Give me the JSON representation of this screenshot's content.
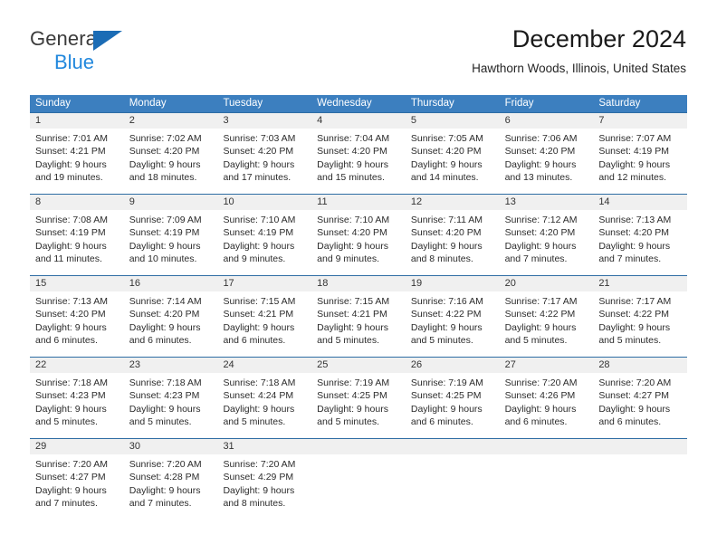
{
  "logo": {
    "word1": "General",
    "word2": "Blue",
    "triangle_color": "#1b6cb5",
    "word2_color": "#2288dd"
  },
  "header": {
    "title": "December 2024",
    "subtitle": "Hawthorn Woods, Illinois, United States"
  },
  "colors": {
    "header_row_bg": "#3c7fbf",
    "week_divider": "#2e6da4",
    "daynum_band_bg": "#f0f0f0",
    "text": "#2b2b2b"
  },
  "calendar": {
    "day_headers": [
      "Sunday",
      "Monday",
      "Tuesday",
      "Wednesday",
      "Thursday",
      "Friday",
      "Saturday"
    ],
    "weeks": [
      {
        "days": [
          {
            "num": "1",
            "sunrise": "Sunrise: 7:01 AM",
            "sunset": "Sunset: 4:21 PM",
            "daylight1": "Daylight: 9 hours",
            "daylight2": "and 19 minutes."
          },
          {
            "num": "2",
            "sunrise": "Sunrise: 7:02 AM",
            "sunset": "Sunset: 4:20 PM",
            "daylight1": "Daylight: 9 hours",
            "daylight2": "and 18 minutes."
          },
          {
            "num": "3",
            "sunrise": "Sunrise: 7:03 AM",
            "sunset": "Sunset: 4:20 PM",
            "daylight1": "Daylight: 9 hours",
            "daylight2": "and 17 minutes."
          },
          {
            "num": "4",
            "sunrise": "Sunrise: 7:04 AM",
            "sunset": "Sunset: 4:20 PM",
            "daylight1": "Daylight: 9 hours",
            "daylight2": "and 15 minutes."
          },
          {
            "num": "5",
            "sunrise": "Sunrise: 7:05 AM",
            "sunset": "Sunset: 4:20 PM",
            "daylight1": "Daylight: 9 hours",
            "daylight2": "and 14 minutes."
          },
          {
            "num": "6",
            "sunrise": "Sunrise: 7:06 AM",
            "sunset": "Sunset: 4:20 PM",
            "daylight1": "Daylight: 9 hours",
            "daylight2": "and 13 minutes."
          },
          {
            "num": "7",
            "sunrise": "Sunrise: 7:07 AM",
            "sunset": "Sunset: 4:19 PM",
            "daylight1": "Daylight: 9 hours",
            "daylight2": "and 12 minutes."
          }
        ]
      },
      {
        "days": [
          {
            "num": "8",
            "sunrise": "Sunrise: 7:08 AM",
            "sunset": "Sunset: 4:19 PM",
            "daylight1": "Daylight: 9 hours",
            "daylight2": "and 11 minutes."
          },
          {
            "num": "9",
            "sunrise": "Sunrise: 7:09 AM",
            "sunset": "Sunset: 4:19 PM",
            "daylight1": "Daylight: 9 hours",
            "daylight2": "and 10 minutes."
          },
          {
            "num": "10",
            "sunrise": "Sunrise: 7:10 AM",
            "sunset": "Sunset: 4:19 PM",
            "daylight1": "Daylight: 9 hours",
            "daylight2": "and 9 minutes."
          },
          {
            "num": "11",
            "sunrise": "Sunrise: 7:10 AM",
            "sunset": "Sunset: 4:20 PM",
            "daylight1": "Daylight: 9 hours",
            "daylight2": "and 9 minutes."
          },
          {
            "num": "12",
            "sunrise": "Sunrise: 7:11 AM",
            "sunset": "Sunset: 4:20 PM",
            "daylight1": "Daylight: 9 hours",
            "daylight2": "and 8 minutes."
          },
          {
            "num": "13",
            "sunrise": "Sunrise: 7:12 AM",
            "sunset": "Sunset: 4:20 PM",
            "daylight1": "Daylight: 9 hours",
            "daylight2": "and 7 minutes."
          },
          {
            "num": "14",
            "sunrise": "Sunrise: 7:13 AM",
            "sunset": "Sunset: 4:20 PM",
            "daylight1": "Daylight: 9 hours",
            "daylight2": "and 7 minutes."
          }
        ]
      },
      {
        "days": [
          {
            "num": "15",
            "sunrise": "Sunrise: 7:13 AM",
            "sunset": "Sunset: 4:20 PM",
            "daylight1": "Daylight: 9 hours",
            "daylight2": "and 6 minutes."
          },
          {
            "num": "16",
            "sunrise": "Sunrise: 7:14 AM",
            "sunset": "Sunset: 4:20 PM",
            "daylight1": "Daylight: 9 hours",
            "daylight2": "and 6 minutes."
          },
          {
            "num": "17",
            "sunrise": "Sunrise: 7:15 AM",
            "sunset": "Sunset: 4:21 PM",
            "daylight1": "Daylight: 9 hours",
            "daylight2": "and 6 minutes."
          },
          {
            "num": "18",
            "sunrise": "Sunrise: 7:15 AM",
            "sunset": "Sunset: 4:21 PM",
            "daylight1": "Daylight: 9 hours",
            "daylight2": "and 5 minutes."
          },
          {
            "num": "19",
            "sunrise": "Sunrise: 7:16 AM",
            "sunset": "Sunset: 4:22 PM",
            "daylight1": "Daylight: 9 hours",
            "daylight2": "and 5 minutes."
          },
          {
            "num": "20",
            "sunrise": "Sunrise: 7:17 AM",
            "sunset": "Sunset: 4:22 PM",
            "daylight1": "Daylight: 9 hours",
            "daylight2": "and 5 minutes."
          },
          {
            "num": "21",
            "sunrise": "Sunrise: 7:17 AM",
            "sunset": "Sunset: 4:22 PM",
            "daylight1": "Daylight: 9 hours",
            "daylight2": "and 5 minutes."
          }
        ]
      },
      {
        "days": [
          {
            "num": "22",
            "sunrise": "Sunrise: 7:18 AM",
            "sunset": "Sunset: 4:23 PM",
            "daylight1": "Daylight: 9 hours",
            "daylight2": "and 5 minutes."
          },
          {
            "num": "23",
            "sunrise": "Sunrise: 7:18 AM",
            "sunset": "Sunset: 4:23 PM",
            "daylight1": "Daylight: 9 hours",
            "daylight2": "and 5 minutes."
          },
          {
            "num": "24",
            "sunrise": "Sunrise: 7:18 AM",
            "sunset": "Sunset: 4:24 PM",
            "daylight1": "Daylight: 9 hours",
            "daylight2": "and 5 minutes."
          },
          {
            "num": "25",
            "sunrise": "Sunrise: 7:19 AM",
            "sunset": "Sunset: 4:25 PM",
            "daylight1": "Daylight: 9 hours",
            "daylight2": "and 5 minutes."
          },
          {
            "num": "26",
            "sunrise": "Sunrise: 7:19 AM",
            "sunset": "Sunset: 4:25 PM",
            "daylight1": "Daylight: 9 hours",
            "daylight2": "and 6 minutes."
          },
          {
            "num": "27",
            "sunrise": "Sunrise: 7:20 AM",
            "sunset": "Sunset: 4:26 PM",
            "daylight1": "Daylight: 9 hours",
            "daylight2": "and 6 minutes."
          },
          {
            "num": "28",
            "sunrise": "Sunrise: 7:20 AM",
            "sunset": "Sunset: 4:27 PM",
            "daylight1": "Daylight: 9 hours",
            "daylight2": "and 6 minutes."
          }
        ]
      },
      {
        "days": [
          {
            "num": "29",
            "sunrise": "Sunrise: 7:20 AM",
            "sunset": "Sunset: 4:27 PM",
            "daylight1": "Daylight: 9 hours",
            "daylight2": "and 7 minutes."
          },
          {
            "num": "30",
            "sunrise": "Sunrise: 7:20 AM",
            "sunset": "Sunset: 4:28 PM",
            "daylight1": "Daylight: 9 hours",
            "daylight2": "and 7 minutes."
          },
          {
            "num": "31",
            "sunrise": "Sunrise: 7:20 AM",
            "sunset": "Sunset: 4:29 PM",
            "daylight1": "Daylight: 9 hours",
            "daylight2": "and 8 minutes."
          },
          {
            "num": "",
            "sunrise": "",
            "sunset": "",
            "daylight1": "",
            "daylight2": ""
          },
          {
            "num": "",
            "sunrise": "",
            "sunset": "",
            "daylight1": "",
            "daylight2": ""
          },
          {
            "num": "",
            "sunrise": "",
            "sunset": "",
            "daylight1": "",
            "daylight2": ""
          },
          {
            "num": "",
            "sunrise": "",
            "sunset": "",
            "daylight1": "",
            "daylight2": ""
          }
        ]
      }
    ]
  }
}
